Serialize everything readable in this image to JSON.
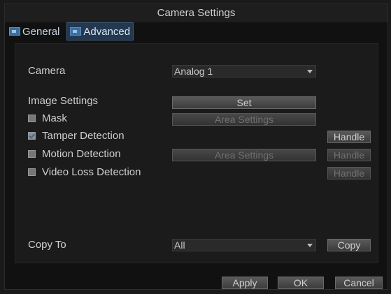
{
  "window": {
    "title": "Camera Settings"
  },
  "tabs": [
    {
      "label": "General",
      "active": false
    },
    {
      "label": "Advanced",
      "active": true
    }
  ],
  "form": {
    "camera_label": "Camera",
    "camera_value": "Analog 1",
    "image_settings_label": "Image Settings",
    "image_settings_button": "Set",
    "mask": {
      "label": "Mask",
      "checked": false,
      "button": "Area Settings"
    },
    "tamper": {
      "label": "Tamper Detection",
      "checked": true,
      "handle": "Handle"
    },
    "motion": {
      "label": "Motion Detection",
      "checked": false,
      "button": "Area Settings",
      "handle": "Handle"
    },
    "video_loss": {
      "label": "Video Loss Detection",
      "checked": false,
      "handle": "Handle"
    },
    "copy_to_label": "Copy To",
    "copy_to_value": "All",
    "copy_button": "Copy"
  },
  "footer": {
    "apply": "Apply",
    "ok": "OK",
    "cancel": "Cancel"
  },
  "colors": {
    "accent": "#3b6fa2",
    "background": "#111111",
    "panel": "#1b1b1b"
  }
}
